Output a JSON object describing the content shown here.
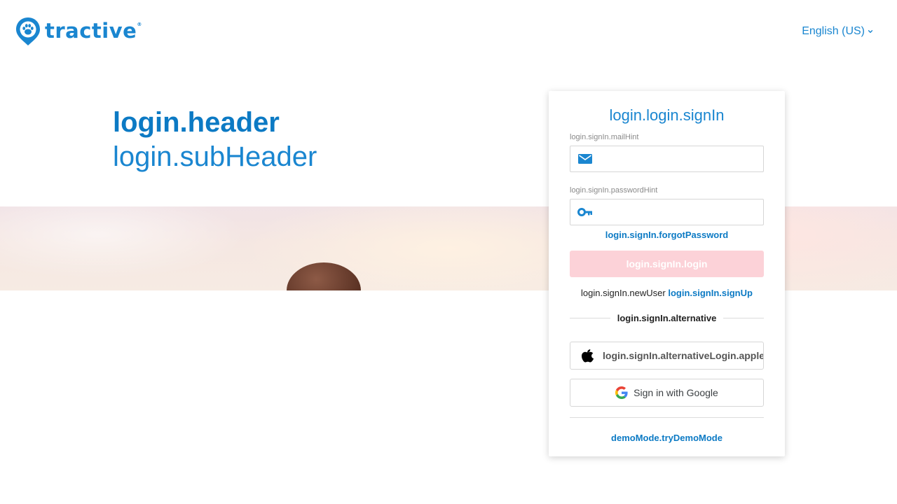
{
  "brand": {
    "name": "tractive",
    "registered": "®",
    "color": "#1a86d0"
  },
  "language": {
    "selected": "English (US)",
    "icon": "chevron-down-icon"
  },
  "hero": {
    "header": "login.header",
    "subheader": "login.subHeader"
  },
  "login_card": {
    "title": "login.login.signIn",
    "email": {
      "label": "login.signIn.mailHint",
      "value": "",
      "icon": "envelope-icon"
    },
    "password": {
      "label": "login.signIn.passwordHint",
      "value": "",
      "icon": "key-icon"
    },
    "forgot_password": "login.signIn.forgotPassword",
    "login_button": "login.signIn.login",
    "login_button_color": "#fcd2d8",
    "new_user_text": "login.signIn.newUser",
    "sign_up_link": "login.signIn.signUp",
    "alternative_label": "login.signIn.alternative",
    "apple_button": "login.signIn.alternativeLogin.apple",
    "google_button": "Sign in with Google",
    "demo_link": "demoMode.tryDemoMode"
  }
}
